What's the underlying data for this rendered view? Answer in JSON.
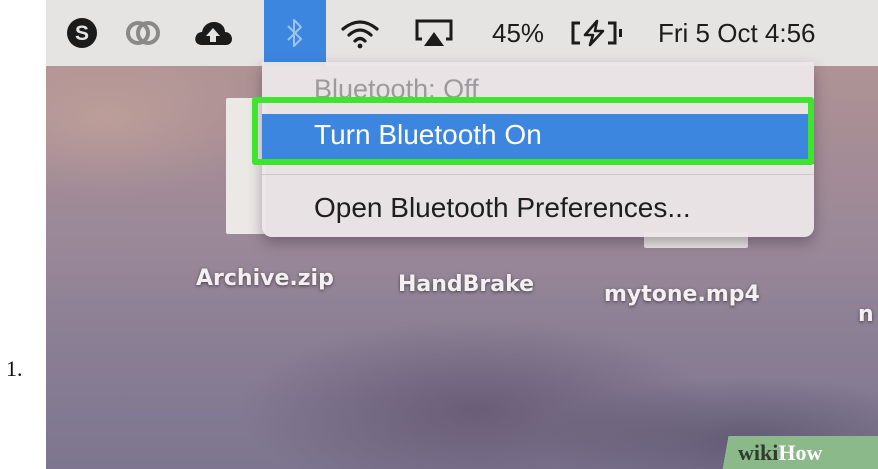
{
  "step": {
    "number": "1."
  },
  "menubar": {
    "icons": [
      {
        "name": "skype-icon"
      },
      {
        "name": "creative-cloud-icon"
      },
      {
        "name": "cloud-upload-icon"
      },
      {
        "name": "bluetooth-icon",
        "state": "active"
      },
      {
        "name": "wifi-icon"
      },
      {
        "name": "airplay-icon"
      },
      {
        "name": "battery-charging-icon"
      }
    ],
    "battery_percent": "45%",
    "clock": "Fri 5 Oct 4:56"
  },
  "bluetooth_menu": {
    "status": "Bluetooth: Off",
    "items": [
      {
        "label": "Turn Bluetooth On",
        "highlighted": true
      },
      {
        "label": "Open Bluetooth Preferences..."
      }
    ]
  },
  "desktop": {
    "icons": [
      {
        "label": "Archive.zip"
      },
      {
        "label": "HandBrake"
      },
      {
        "label": "mytone.mp4"
      },
      {
        "label": "n"
      }
    ]
  },
  "watermark": {
    "part1": "wiki",
    "part2": "How"
  },
  "colors": {
    "accent_blue": "#3d86e0",
    "highlight_green": "#3fe42e",
    "menubar_bg": "#e6e3e3",
    "watermark_green": "#8bb98a"
  }
}
